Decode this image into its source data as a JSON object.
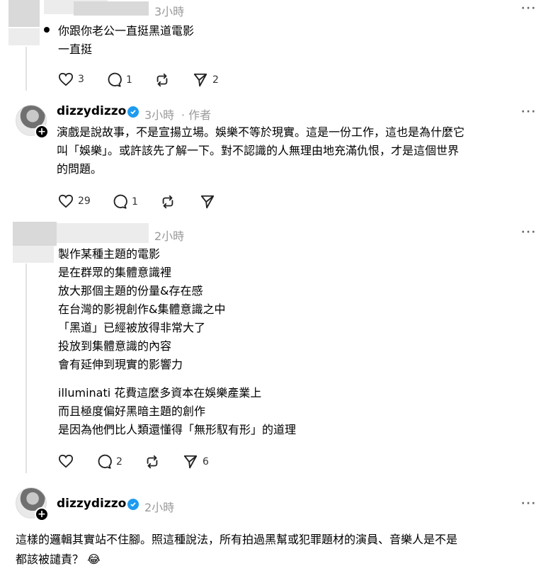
{
  "posts": [
    {
      "time": "3小時",
      "lines": [
        "你跟你老公一直挺黑道電影",
        "一直挺"
      ],
      "likes": "3",
      "replies": "1",
      "shares": "2",
      "more": "···"
    },
    {
      "username": "dizzydizzo",
      "time": "3小時",
      "author_tag": "· 作者",
      "lines": [
        "演戲是說故事，不是宣揚立場。娛樂不等於現實。這是一份工作，這也是為什麼它",
        "叫「娛樂」。或許該先了解一下。對不認識的人無理由地充滿仇恨，才是這個世界",
        "的問題。"
      ],
      "likes": "29",
      "replies": "1",
      "more": "···"
    },
    {
      "time": "2小時",
      "lines": [
        "製作某種主題的電影",
        "是在群眾的集體意識裡",
        "放大那個主題的份量&存在感",
        "在台灣的影視創作&集體意識之中",
        "「黑道」已經被放得非常大了",
        "投放到集體意識的內容",
        "會有延伸到現實的影響力"
      ],
      "lines2": [
        "illuminati 花費這麼多資本在娛樂產業上",
        "而且極度偏好黑暗主題的創作",
        "是因為他們比人類還懂得「無形馭有形」的道理"
      ],
      "replies": "2",
      "shares": "6",
      "more": "···"
    },
    {
      "username": "dizzydizzo",
      "time": "2小時",
      "lines": [
        "這樣的邏輯其實站不住腳。照這種說法，所有拍過黑幫或犯罪題材的演員、音樂人是不是",
        "都該被譴責？ 😂"
      ],
      "more": "···"
    }
  ],
  "colors": {
    "verified": "#1d9bf0",
    "muted": "#999999"
  },
  "icons": [
    "heart-icon",
    "comment-icon",
    "repost-icon",
    "share-icon",
    "more-icon",
    "verified-icon",
    "follow-plus-icon"
  ]
}
